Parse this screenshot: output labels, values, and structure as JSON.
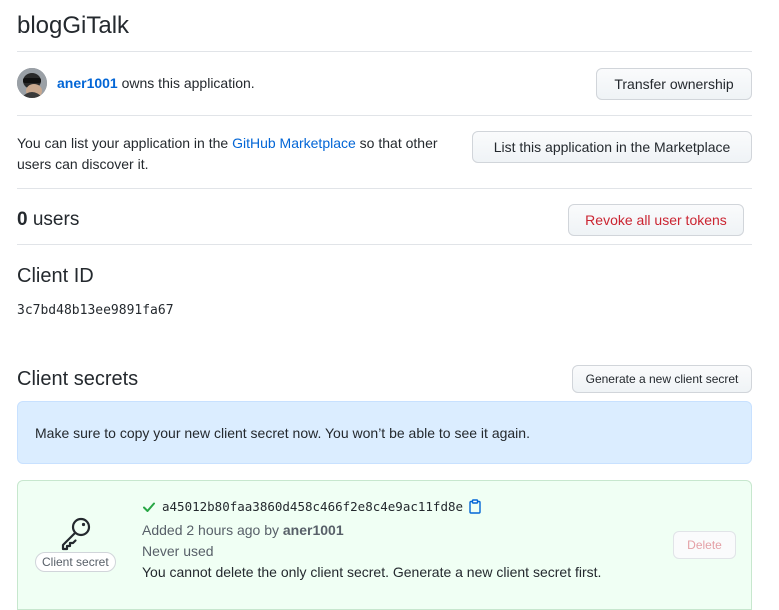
{
  "app": {
    "title": "blogGiTalk"
  },
  "owner": {
    "username": "aner1001",
    "owns_text": "owns this application.",
    "transfer_label": "Transfer ownership"
  },
  "marketplace": {
    "text_before": "You can list your application in the ",
    "link_text": "GitHub Marketplace",
    "text_after_line1": " so that other",
    "text_line2": "users can discover it.",
    "button_label": "List this application in the Marketplace"
  },
  "users": {
    "count": "0",
    "label": "users",
    "revoke_label": "Revoke all user tokens"
  },
  "client_id": {
    "heading": "Client ID",
    "value": "3c7bd48b13ee9891fa67"
  },
  "client_secrets": {
    "heading": "Client secrets",
    "generate_label": "Generate a new client secret",
    "flash": "Make sure to copy your new client secret now. You won’t be able to see it again.",
    "secret": {
      "value": "a45012b80faa3860d458c466f2e8c4e9ac11fd8e",
      "added_prefix": "Added 2 hours ago by ",
      "added_by": "aner1001",
      "usage": "Never used",
      "note": "You cannot delete the only client secret. Generate a new client secret first.",
      "badge": "Client secret",
      "delete_label": "Delete"
    }
  },
  "colors": {
    "link": "#0366d6",
    "danger": "#cb2431",
    "success": "#28a745",
    "flash_bg": "#dbedff",
    "secret_bg": "#f0fff4"
  },
  "icons": [
    "avatar",
    "check-icon",
    "clipboard-icon",
    "key-icon"
  ]
}
